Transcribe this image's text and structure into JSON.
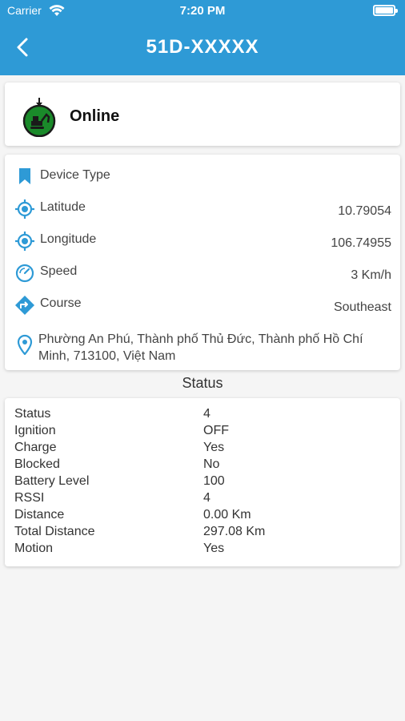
{
  "status_bar": {
    "carrier": "Carrier",
    "time": "7:20 PM"
  },
  "header": {
    "title": "51D-XXXXX"
  },
  "online_card": {
    "label": "Online",
    "icon": "excavator-map-pin-icon",
    "status_color": "#1a8a2a"
  },
  "info": {
    "device_type_label": "Device Type",
    "latitude_label": "Latitude",
    "latitude_value": "10.79054",
    "longitude_label": "Longitude",
    "longitude_value": "106.74955",
    "speed_label": "Speed",
    "speed_value": "3 Km/h",
    "course_label": "Course",
    "course_value": "Southeast",
    "address_line1": "Phường An Phú, Thành phố Thủ Đức, Thành phố Hồ Chí",
    "address_line2": "Minh, 713100, Việt Nam"
  },
  "status_section": {
    "title": "Status",
    "rows": [
      {
        "key": "Status",
        "value": "4"
      },
      {
        "key": "Ignition",
        "value": "OFF"
      },
      {
        "key": "Charge",
        "value": "Yes"
      },
      {
        "key": "Blocked",
        "value": "No"
      },
      {
        "key": "Battery Level",
        "value": "100"
      },
      {
        "key": "RSSI",
        "value": "4"
      },
      {
        "key": "Distance",
        "value": "0.00 Km"
      },
      {
        "key": "Total Distance",
        "value": "297.08 Km"
      },
      {
        "key": "Motion",
        "value": "Yes"
      }
    ]
  },
  "colors": {
    "accent": "#2e9ad6",
    "icon_blue": "#2e9ad6"
  }
}
